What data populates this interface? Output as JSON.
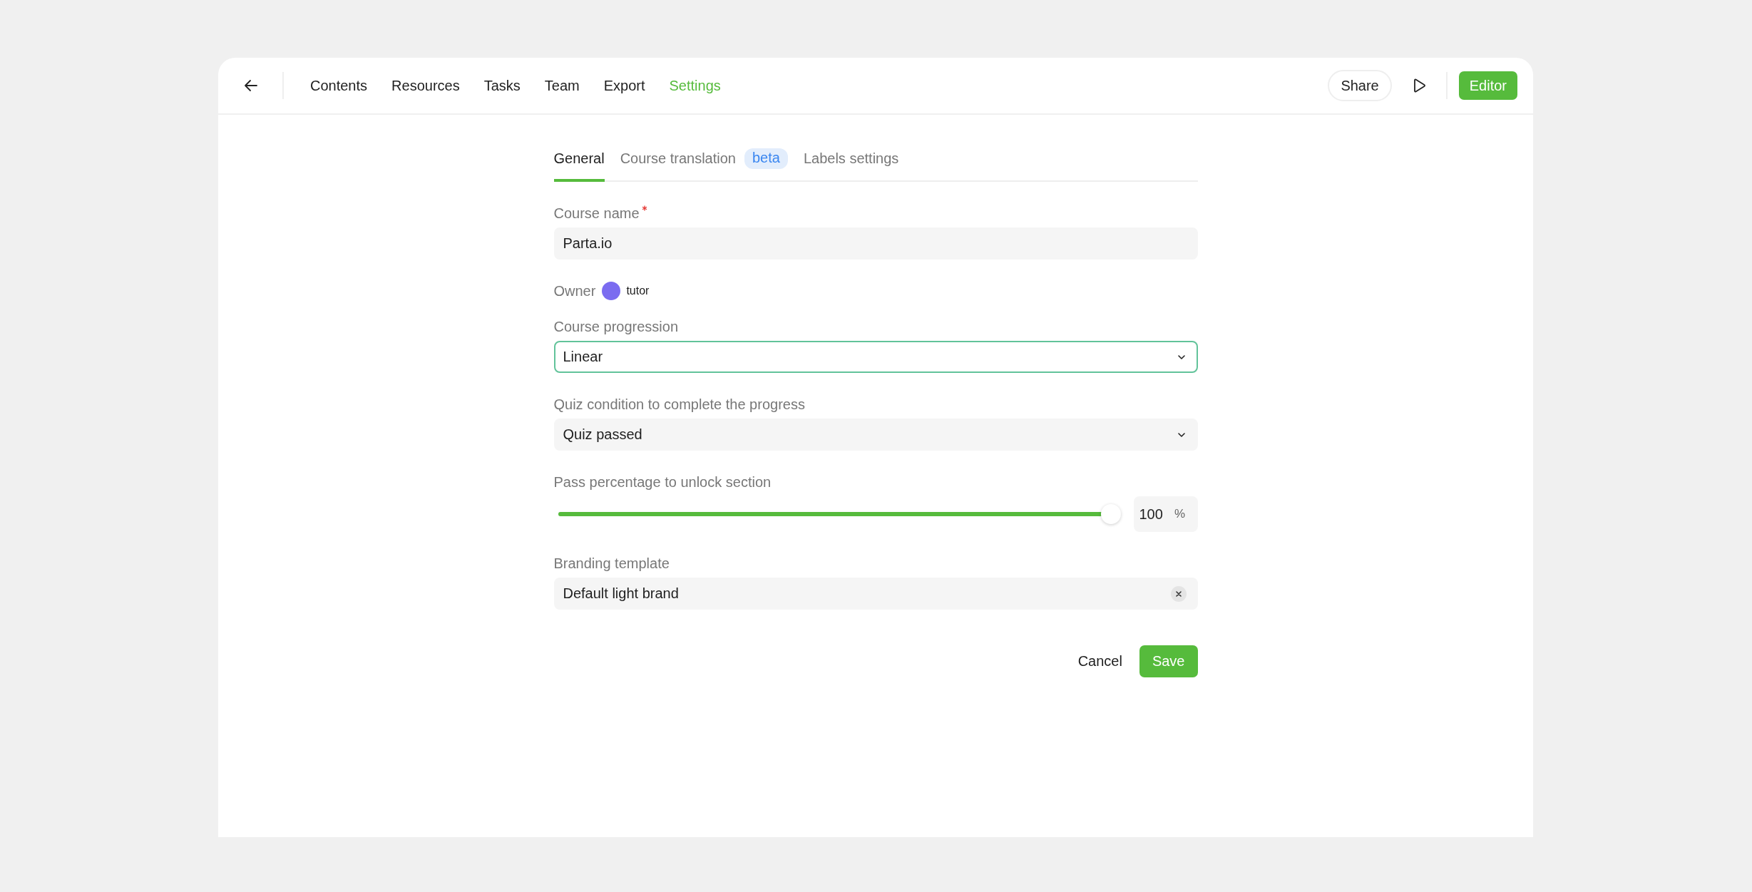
{
  "nav": [
    {
      "label": "Contents",
      "selected": false
    },
    {
      "label": "Resources",
      "selected": false
    },
    {
      "label": "Tasks",
      "selected": false
    },
    {
      "label": "Team",
      "selected": false
    },
    {
      "label": "Export",
      "selected": false
    },
    {
      "label": "Settings",
      "selected": true
    }
  ],
  "actions": {
    "share": "Share",
    "editor": "Editor"
  },
  "tabs": [
    {
      "label": "General",
      "selected": true
    },
    {
      "label": "Course translation",
      "selected": false,
      "badge": "beta"
    },
    {
      "label": "Labels settings",
      "selected": false
    }
  ],
  "course_name": {
    "label": "Course name",
    "required": true,
    "value": "Parta.io"
  },
  "owner": {
    "label": "Owner",
    "name": "tutor",
    "color": "#7b6cf0"
  },
  "course_progression": {
    "label": "Course progression",
    "value": "Linear",
    "focused": true
  },
  "quiz_condition": {
    "label": "Quiz condition to complete the progress",
    "value": "Quiz passed",
    "focused": false
  },
  "pass_percentage": {
    "label": "Pass percentage to unlock section",
    "level": 1.0,
    "value": "100",
    "unit": "%"
  },
  "branding_template": {
    "label": "Branding template",
    "value": "Default light brand"
  },
  "buttons": {
    "cancel": "Cancel",
    "save": "Save"
  }
}
